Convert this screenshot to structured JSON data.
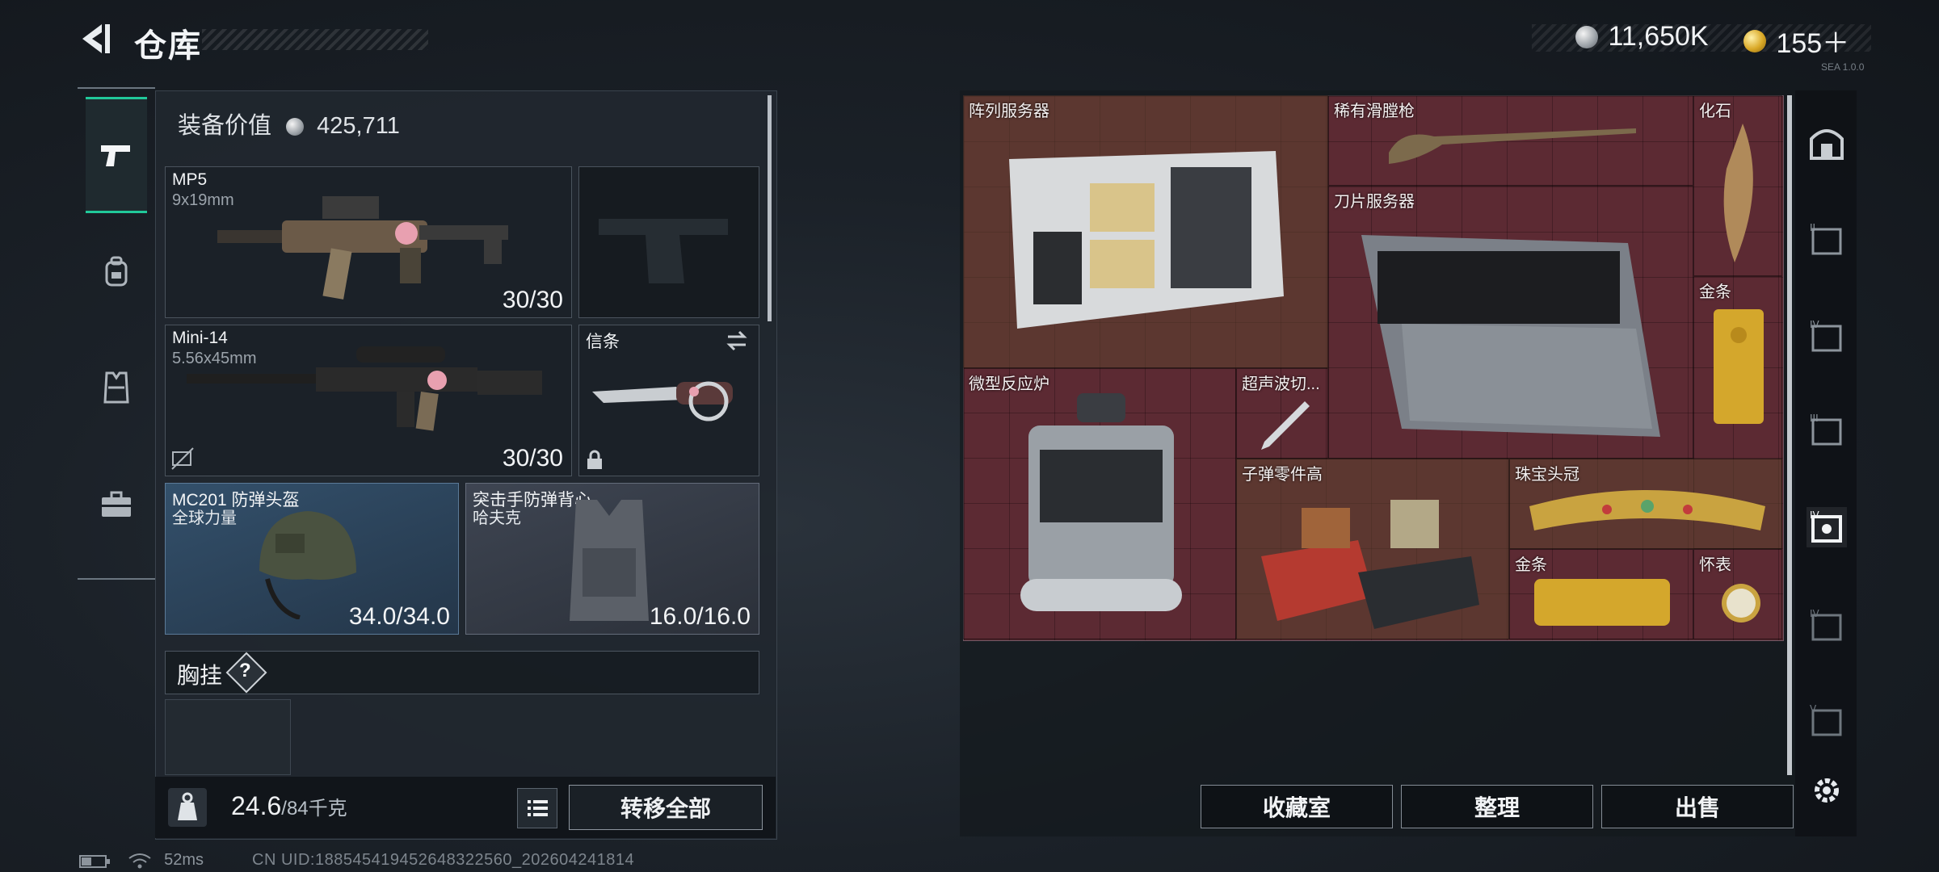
{
  "header": {
    "title": "仓库",
    "currency_silver": "11,650K",
    "currency_gold": "155＋",
    "corner_note": "SEA 1.0.0"
  },
  "loadout": {
    "equip_value_label": "装备价值",
    "equip_value": "425,711",
    "primary_weapon": {
      "name": "MP5",
      "caliber": "9x19mm",
      "ammo": "30/30"
    },
    "sidearm_slot_empty": true,
    "secondary_weapon": {
      "name": "Mini-14",
      "caliber": "5.56x45mm",
      "ammo": "30/30"
    },
    "melee": {
      "name": "信条"
    },
    "helmet": {
      "name": "MC201 防弹头盔",
      "brand": "全球力量",
      "durability": "34.0/34.0"
    },
    "armor": {
      "name": "突击手防弹背心",
      "brand": "哈夫克",
      "durability": "16.0/16.0"
    },
    "chest_rig_label": "胸挂",
    "chest_rig_help": "?",
    "weight_current": "24.6",
    "weight_max": "/84千克",
    "transfer_all": "转移全部"
  },
  "stash": {
    "items": [
      {
        "name": "阵列服务器",
        "color": "#5c422e"
      },
      {
        "name": "稀有滑膛枪",
        "color": "#5c2a33"
      },
      {
        "name": "化石",
        "color": "#5c2a33"
      },
      {
        "name": "刀片服务器",
        "color": "#5c2a33"
      },
      {
        "name": "金条",
        "color": "#5c2a33"
      },
      {
        "name": "微型反应炉",
        "color": "#5c2a33"
      },
      {
        "name": "超声波切...",
        "color": "#5c2a33"
      },
      {
        "name": "子弹零件高",
        "color": "#5c422e"
      },
      {
        "name": "珠宝头冠",
        "color": "#5c422e"
      },
      {
        "name": "金条",
        "color": "#5c2a33"
      },
      {
        "name": "怀表",
        "color": "#5c2a33"
      }
    ],
    "buttons": {
      "collection": "收藏室",
      "organize": "整理",
      "sell": "出售"
    },
    "side_tabs": [
      "I",
      "II",
      "IV",
      "III",
      "IV",
      "IV",
      "V"
    ]
  },
  "status_bar": {
    "ping": "52ms",
    "uid": "CN UID:18854541945264832256​0_202604241814"
  }
}
